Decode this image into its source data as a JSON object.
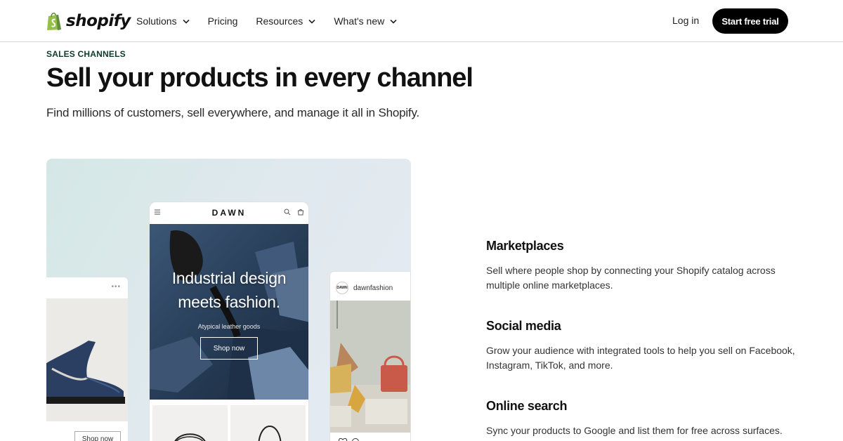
{
  "nav": {
    "logo_text": "shopify",
    "links": [
      {
        "label": "Solutions",
        "has_dropdown": true
      },
      {
        "label": "Pricing",
        "has_dropdown": false
      },
      {
        "label": "Resources",
        "has_dropdown": true
      },
      {
        "label": "What's new",
        "has_dropdown": true
      }
    ],
    "login_label": "Log in",
    "cta_label": "Start free trial"
  },
  "hero": {
    "eyebrow": "SALES CHANNELS",
    "headline": "Sell your products in every channel",
    "subheadline": "Find millions of customers, sell everywhere, and manage it all in Shopify."
  },
  "showcase": {
    "phone": {
      "brand": "DAWN",
      "hero_title_line1": "Industrial design",
      "hero_title_line2": "meets fashion.",
      "hero_subtitle": "Atypical leather goods",
      "hero_button": "Shop now"
    },
    "left_card": {
      "button": "Shop now"
    },
    "right_card": {
      "avatar_text": "DAWN",
      "handle": "dawnfashion"
    }
  },
  "features": [
    {
      "title": "Marketplaces",
      "body": "Sell where people shop by connecting your Shopify catalog across multiple online marketplaces."
    },
    {
      "title": "Social media",
      "body": "Grow your audience with integrated tools to help you sell on Facebook, Instagram, TikTok, and more."
    },
    {
      "title": "Online search",
      "body": "Sync your products to Google and list them for free across surfaces."
    }
  ],
  "colors": {
    "brand_green": "#95bf47",
    "eyebrow_green": "#0e3a2b",
    "cta_bg": "#000000",
    "showcase_bg": "#dfe9ee"
  },
  "icons": [
    "shopify-bag-icon",
    "chevron-down-icon",
    "menu-icon",
    "search-icon",
    "cart-icon",
    "heart-icon",
    "comment-icon"
  ]
}
